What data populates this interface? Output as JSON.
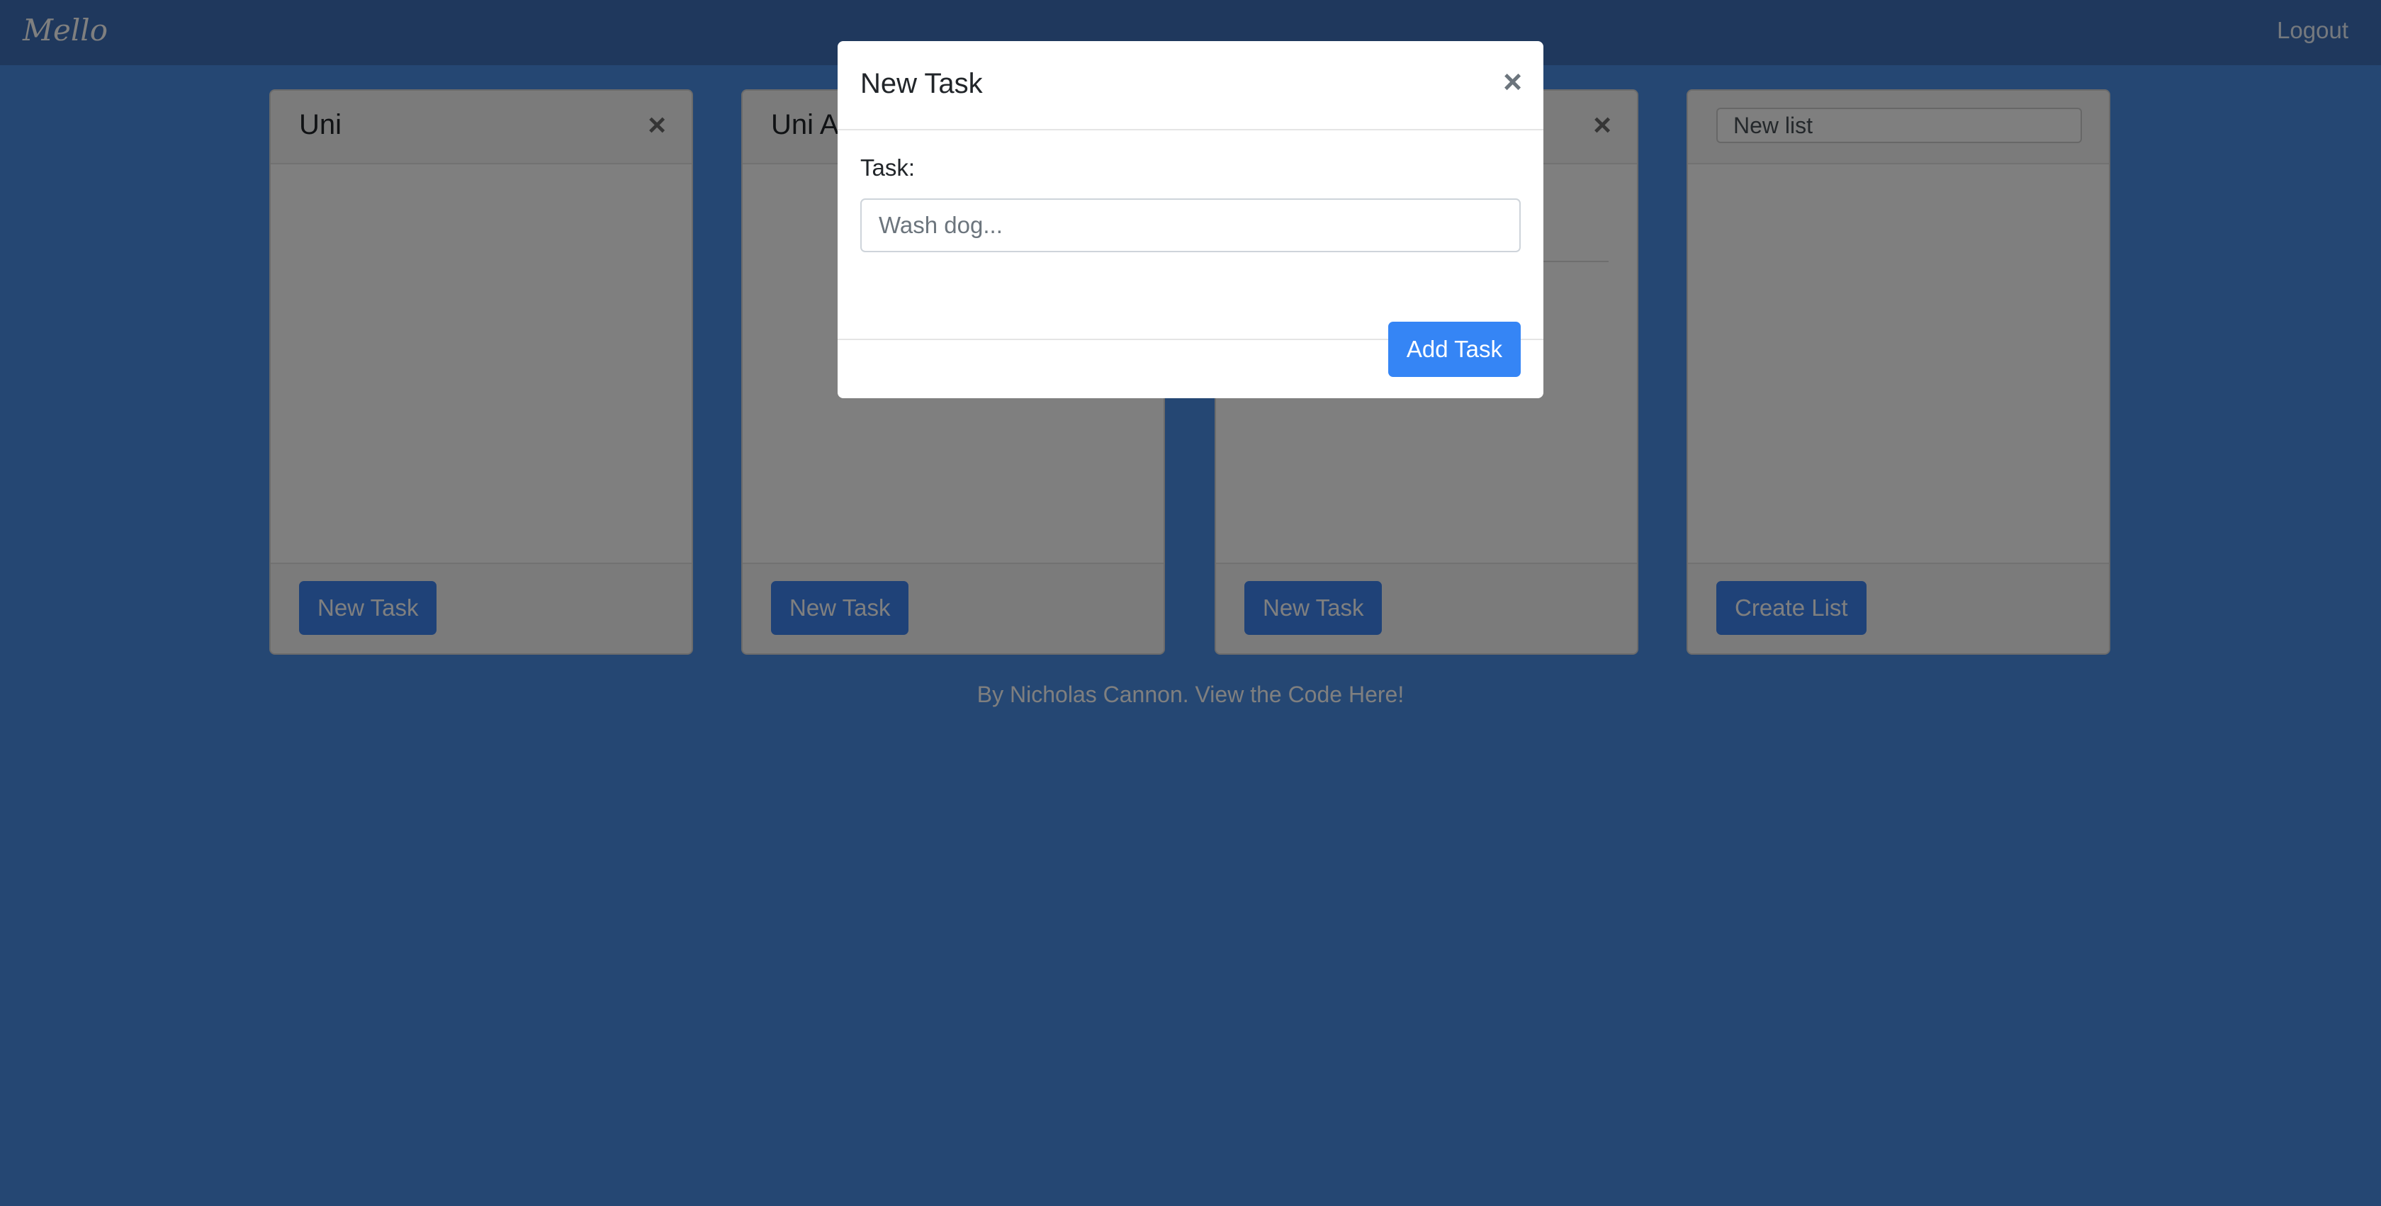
{
  "navbar": {
    "brand": "Mello",
    "logout": "Logout"
  },
  "lists": [
    {
      "title": "Uni",
      "button": "New Task"
    },
    {
      "title": "Uni A",
      "button": "New Task"
    },
    {
      "title": "",
      "button": "New Task"
    },
    {
      "input_value": "New list",
      "button": "Create List"
    }
  ],
  "footer": {
    "text": "By Nicholas Cannon. View the Code Here!"
  },
  "modal": {
    "title": "New Task",
    "close": "×",
    "task_label": "Task:",
    "task_placeholder": "Wash dog...",
    "add_button": "Add Task"
  },
  "icons": {
    "close": "×"
  },
  "colors": {
    "navbar": "#3e71ba",
    "background": "#4a8fe6",
    "primary": "#3585f5"
  }
}
